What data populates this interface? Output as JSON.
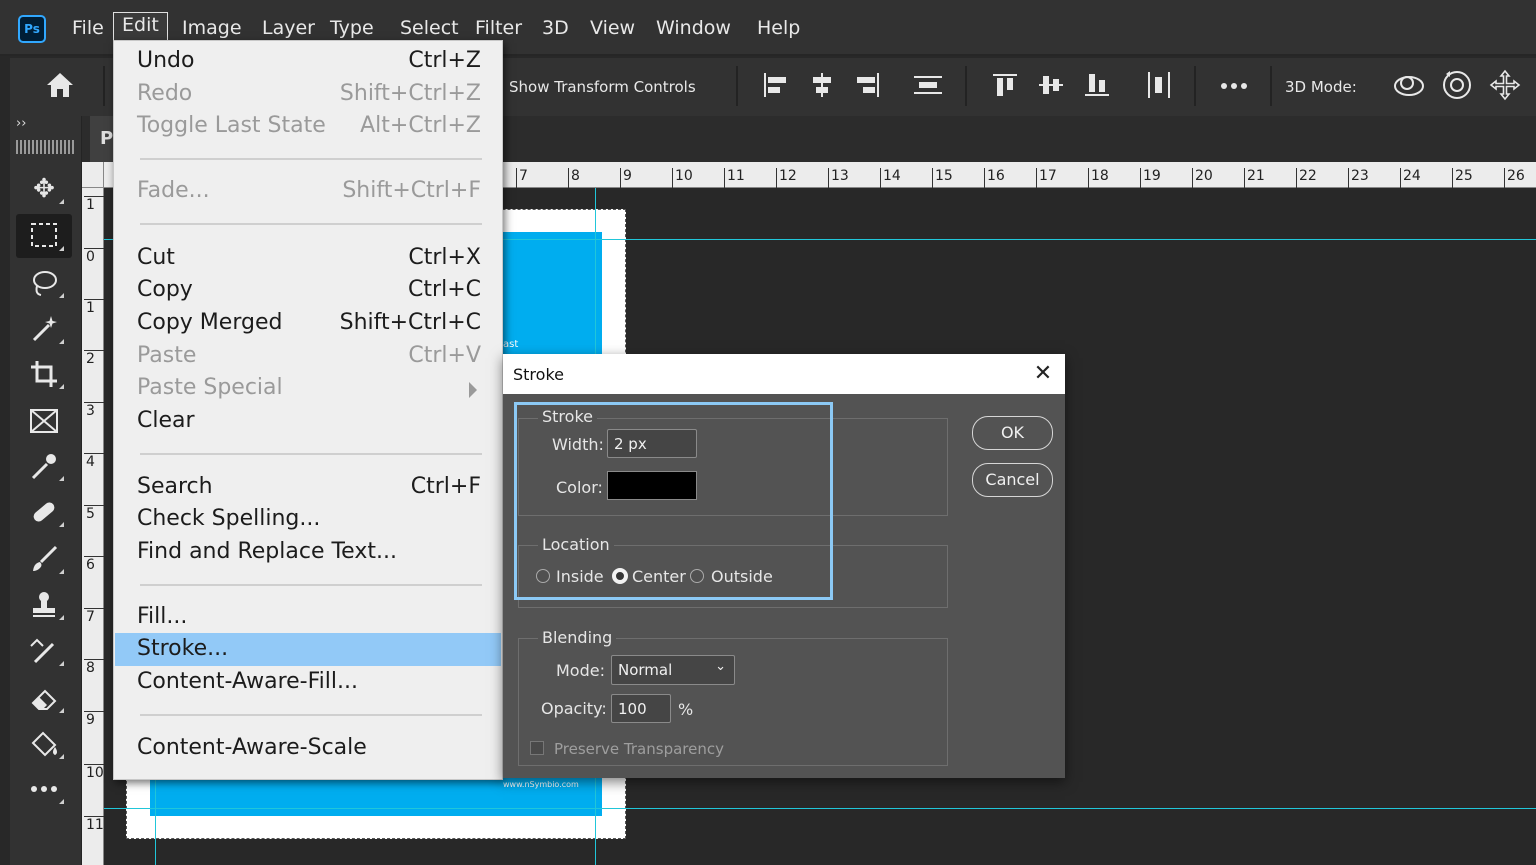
{
  "app": {
    "logo_text": "Ps",
    "accent_color": "#31a8ff"
  },
  "menubar": {
    "items": [
      "File",
      "Edit",
      "Image",
      "Layer",
      "Type",
      "Select",
      "Filter",
      "3D",
      "View",
      "Window",
      "Help"
    ],
    "active": "Edit"
  },
  "optionsbar": {
    "show_transform_controls": "Show Transform Controls",
    "mode_3d": "3D Mode:",
    "icons": [
      "home-icon",
      "align-left-edges-icon",
      "align-horizontal-centers-icon",
      "align-right-edges-icon",
      "distribute-vertical-icon",
      "align-top-edges-icon",
      "align-vertical-centers-icon",
      "align-bottom-edges-icon",
      "distribute-horizontal-icon",
      "more-icon",
      "orbit-3d-icon",
      "rotate-3d-icon",
      "pan-3d-icon"
    ]
  },
  "tools": [
    "move-tool-icon",
    "marquee-tool-icon",
    "lasso-tool-icon",
    "magic-wand-tool-icon",
    "crop-tool-icon",
    "frame-tool-icon",
    "eyedropper-tool-icon",
    "healing-brush-tool-icon",
    "brush-tool-icon",
    "clone-stamp-tool-icon",
    "history-brush-tool-icon",
    "eraser-tool-icon",
    "paint-bucket-tool-icon",
    "more-tools-icon"
  ],
  "document": {
    "tab_label": "P",
    "partial_text": "ast",
    "url_text": "www.nSymbio.com",
    "blue_color": "#00adef",
    "guide_color": "#21c6d9"
  },
  "rulers": {
    "horizontal": [
      "7",
      "8",
      "9",
      "10",
      "11",
      "12",
      "13",
      "14",
      "15",
      "16",
      "17",
      "18",
      "19",
      "20",
      "21",
      "22",
      "23",
      "24",
      "25",
      "26"
    ],
    "vertical": [
      "1",
      "0",
      "1",
      "2",
      "3",
      "4",
      "5",
      "6",
      "7",
      "8",
      "9",
      "10",
      "11"
    ]
  },
  "edit_menu": {
    "items": [
      {
        "label": "Undo",
        "shortcut": "Ctrl+Z",
        "enabled": true
      },
      {
        "label": "Redo",
        "shortcut": "Shift+Ctrl+Z",
        "enabled": false
      },
      {
        "label": "Toggle Last State",
        "shortcut": "Alt+Ctrl+Z",
        "enabled": false
      },
      {
        "label": "Fade...",
        "shortcut": "Shift+Ctrl+F",
        "enabled": false
      },
      {
        "label": "Cut",
        "shortcut": "Ctrl+X",
        "enabled": true
      },
      {
        "label": "Copy",
        "shortcut": "Ctrl+C",
        "enabled": true
      },
      {
        "label": "Copy Merged",
        "shortcut": "Shift+Ctrl+C",
        "enabled": true
      },
      {
        "label": "Paste",
        "shortcut": "Ctrl+V",
        "enabled": false
      },
      {
        "label": "Paste Special",
        "shortcut": "",
        "enabled": false
      },
      {
        "label": "Clear",
        "shortcut": "",
        "enabled": true
      },
      {
        "label": "Search",
        "shortcut": "Ctrl+F",
        "enabled": true
      },
      {
        "label": "Check Spelling...",
        "shortcut": "",
        "enabled": true
      },
      {
        "label": "Find and Replace Text...",
        "shortcut": "",
        "enabled": true
      },
      {
        "label": "Fill...",
        "shortcut": "",
        "enabled": true
      },
      {
        "label": "Stroke...",
        "shortcut": "",
        "enabled": true,
        "highlighted": true
      },
      {
        "label": "Content-Aware-Fill...",
        "shortcut": "",
        "enabled": true
      },
      {
        "label": "Content-Aware-Scale",
        "shortcut": "",
        "enabled": true
      }
    ],
    "highlight_color": "#92c9f7"
  },
  "stroke_dialog": {
    "title": "Stroke",
    "stroke_group": "Stroke",
    "width_label": "Width:",
    "width_value": "2 px",
    "color_label": "Color:",
    "color_value": "#000000",
    "location_group": "Location",
    "location_options": [
      "Inside",
      "Center",
      "Outside"
    ],
    "location_selected": "Center",
    "blending_group": "Blending",
    "mode_label": "Mode:",
    "mode_value": "Normal",
    "opacity_label": "Opacity:",
    "opacity_value": "100",
    "opacity_unit": "%",
    "preserve_transparency": "Preserve Transparency",
    "preserve_checked": false,
    "ok_label": "OK",
    "cancel_label": "Cancel",
    "highlight_box_color": "#8cc9f5"
  }
}
